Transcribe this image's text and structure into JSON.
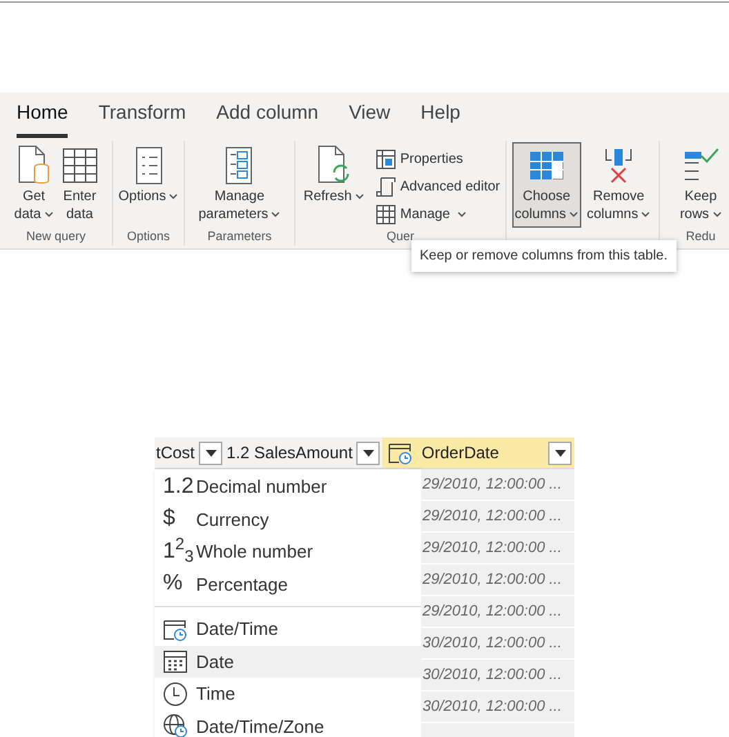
{
  "ribbon": {
    "tabs": [
      {
        "label": "Home",
        "selected": true
      },
      {
        "label": "Transform",
        "selected": false
      },
      {
        "label": "Add column",
        "selected": false
      },
      {
        "label": "View",
        "selected": false
      },
      {
        "label": "Help",
        "selected": false
      }
    ],
    "groups": [
      {
        "label": "New query",
        "items": [
          {
            "kind": "large",
            "lines": [
              "Get",
              "data"
            ],
            "caret": true,
            "selected": false
          },
          {
            "kind": "large",
            "lines": [
              "Enter",
              "data"
            ],
            "caret": false,
            "selected": false
          }
        ]
      },
      {
        "label": "Options",
        "items": [
          {
            "kind": "large",
            "lines": [
              "Options"
            ],
            "caret": true,
            "selected": false
          }
        ]
      },
      {
        "label": "Parameters",
        "items": [
          {
            "kind": "large",
            "lines": [
              "Manage",
              "parameters"
            ],
            "caret": true,
            "selected": false
          }
        ]
      },
      {
        "label": "Quer",
        "items": [
          {
            "kind": "large",
            "lines": [
              "Refresh"
            ],
            "caret": true,
            "selected": false
          },
          {
            "kind": "small",
            "entries": [
              {
                "label": "Properties",
                "caret": false
              },
              {
                "label": "Advanced editor",
                "caret": false
              },
              {
                "label": "Manage",
                "caret": true
              }
            ]
          }
        ]
      },
      {
        "items": [
          {
            "kind": "large",
            "lines": [
              "Choose",
              "columns"
            ],
            "caret": true,
            "selected": true
          },
          {
            "kind": "large",
            "lines": [
              "Remove",
              "columns"
            ],
            "caret": true,
            "selected": false
          }
        ]
      },
      {
        "label": "Redu",
        "items": [
          {
            "kind": "large",
            "lines": [
              "Keep",
              "rows"
            ],
            "caret": true,
            "selected": false
          }
        ]
      }
    ],
    "tooltip": "Keep or remove columns from this table."
  },
  "table": {
    "headers": [
      {
        "kind": "plain",
        "label": "tCost",
        "highlighted": false
      },
      {
        "kind": "plain",
        "label": "1.2 SalesAmount",
        "highlighted": false
      },
      {
        "kind": "datetime",
        "label": "OrderDate",
        "highlighted": true
      }
    ],
    "cells": [
      "29/2010, 12:00:00 ...",
      "29/2010, 12:00:00 ...",
      "29/2010, 12:00:00 ...",
      "29/2010, 12:00:00 ...",
      "29/2010, 12:00:00 ...",
      "30/2010, 12:00:00 ...",
      "30/2010, 12:00:00 ...",
      "30/2010, 12:00:00 ..."
    ]
  },
  "type_menu": {
    "groups": [
      [
        {
          "kind": "symbol",
          "symbol": "1.2",
          "label": "Decimal number",
          "selected": false
        },
        {
          "kind": "symbol",
          "symbol": "$",
          "label": "Currency",
          "selected": false
        },
        {
          "kind": "symbol",
          "symbol": "1$^{2}$$_{3}$",
          "label": "Whole number",
          "selected": false
        },
        {
          "kind": "symbol",
          "symbol": "%",
          "label": "Percentage",
          "selected": false
        }
      ],
      [
        {
          "kind": "datetime",
          "label": "Date/Time",
          "selected": false
        },
        {
          "kind": "date",
          "label": "Date",
          "selected": true
        },
        {
          "kind": "time",
          "label": "Time",
          "selected": false
        },
        {
          "kind": "zone",
          "label": "Date/Time/Zone",
          "selected": false
        }
      ]
    ]
  }
}
